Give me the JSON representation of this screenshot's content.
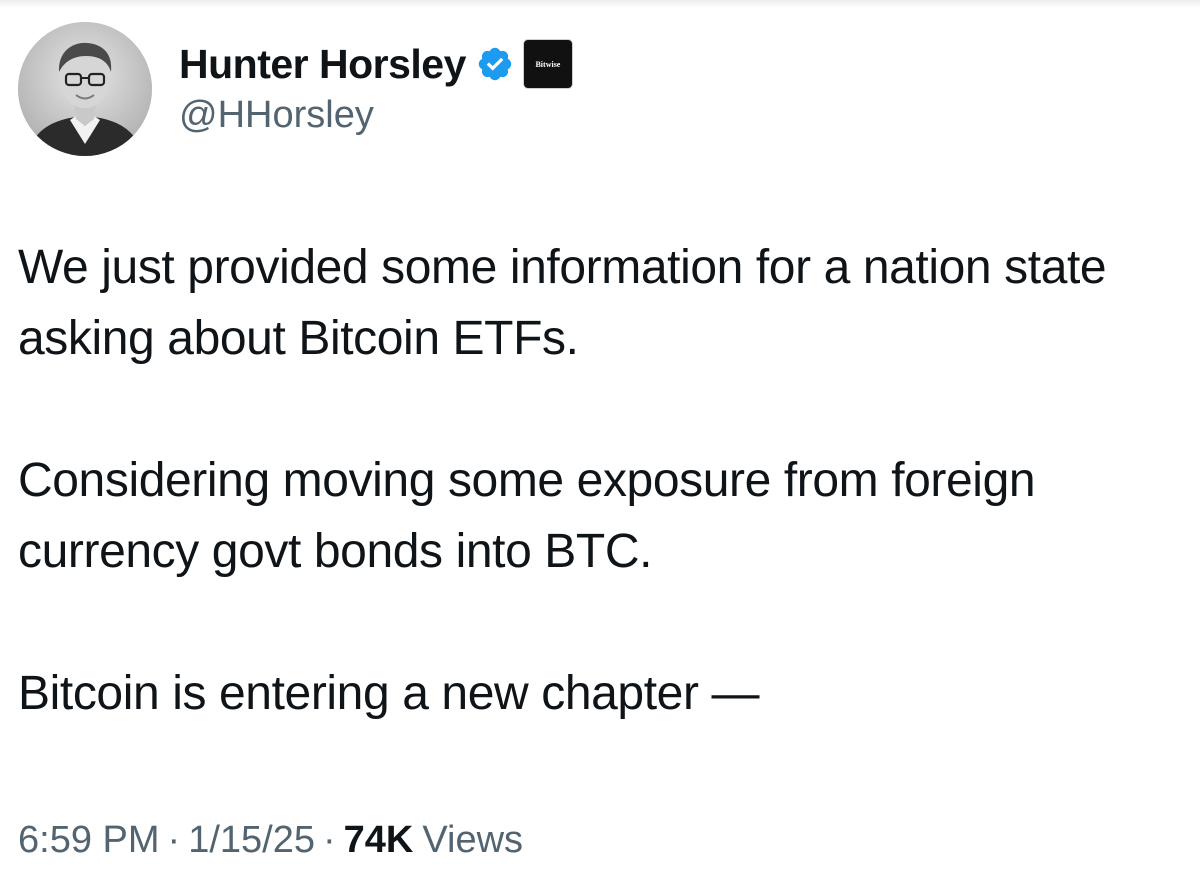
{
  "author": {
    "display_name": "Hunter Horsley",
    "handle": "@HHorsley",
    "verified": true,
    "verified_color": "#1d9bf0",
    "affiliate_badge_text": "Bitwise",
    "avatar_icon": "profile-photo"
  },
  "tweet": {
    "paragraphs": [
      "We just provided some information for a nation state asking about Bitcoin ETFs.",
      "Considering moving some exposure from foreign currency govt bonds into BTC.",
      "Bitcoin is entering a new chapter —"
    ]
  },
  "meta": {
    "time": "6:59 PM",
    "separator": "·",
    "date": "1/15/25",
    "views_count": "74K",
    "views_label": "Views"
  },
  "colors": {
    "text_primary": "#0f1419",
    "text_secondary": "#536471",
    "background": "#ffffff"
  }
}
